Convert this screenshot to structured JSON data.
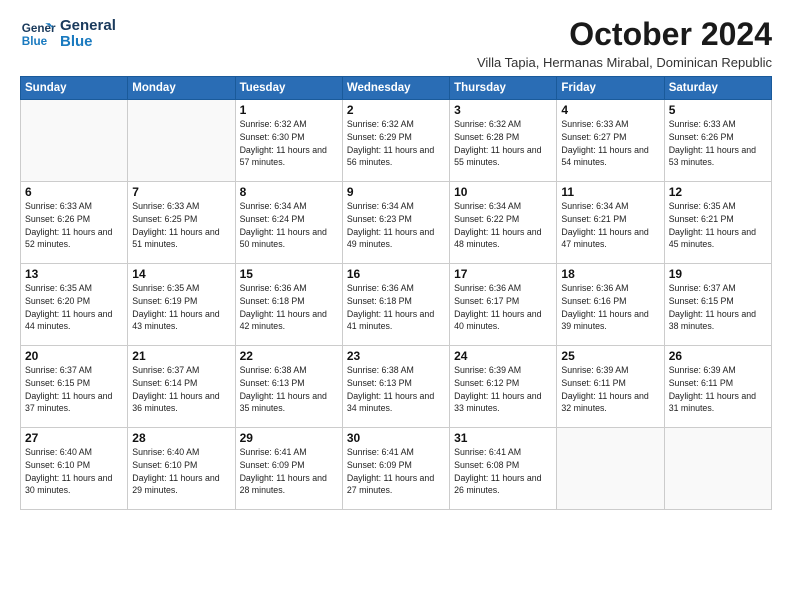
{
  "logo": {
    "line1": "General",
    "line2": "Blue"
  },
  "title": "October 2024",
  "subtitle": "Villa Tapia, Hermanas Mirabal, Dominican Republic",
  "weekdays": [
    "Sunday",
    "Monday",
    "Tuesday",
    "Wednesday",
    "Thursday",
    "Friday",
    "Saturday"
  ],
  "weeks": [
    [
      {
        "day": "",
        "info": ""
      },
      {
        "day": "",
        "info": ""
      },
      {
        "day": "1",
        "info": "Sunrise: 6:32 AM\nSunset: 6:30 PM\nDaylight: 11 hours\nand 57 minutes."
      },
      {
        "day": "2",
        "info": "Sunrise: 6:32 AM\nSunset: 6:29 PM\nDaylight: 11 hours\nand 56 minutes."
      },
      {
        "day": "3",
        "info": "Sunrise: 6:32 AM\nSunset: 6:28 PM\nDaylight: 11 hours\nand 55 minutes."
      },
      {
        "day": "4",
        "info": "Sunrise: 6:33 AM\nSunset: 6:27 PM\nDaylight: 11 hours\nand 54 minutes."
      },
      {
        "day": "5",
        "info": "Sunrise: 6:33 AM\nSunset: 6:26 PM\nDaylight: 11 hours\nand 53 minutes."
      }
    ],
    [
      {
        "day": "6",
        "info": "Sunrise: 6:33 AM\nSunset: 6:26 PM\nDaylight: 11 hours\nand 52 minutes."
      },
      {
        "day": "7",
        "info": "Sunrise: 6:33 AM\nSunset: 6:25 PM\nDaylight: 11 hours\nand 51 minutes."
      },
      {
        "day": "8",
        "info": "Sunrise: 6:34 AM\nSunset: 6:24 PM\nDaylight: 11 hours\nand 50 minutes."
      },
      {
        "day": "9",
        "info": "Sunrise: 6:34 AM\nSunset: 6:23 PM\nDaylight: 11 hours\nand 49 minutes."
      },
      {
        "day": "10",
        "info": "Sunrise: 6:34 AM\nSunset: 6:22 PM\nDaylight: 11 hours\nand 48 minutes."
      },
      {
        "day": "11",
        "info": "Sunrise: 6:34 AM\nSunset: 6:21 PM\nDaylight: 11 hours\nand 47 minutes."
      },
      {
        "day": "12",
        "info": "Sunrise: 6:35 AM\nSunset: 6:21 PM\nDaylight: 11 hours\nand 45 minutes."
      }
    ],
    [
      {
        "day": "13",
        "info": "Sunrise: 6:35 AM\nSunset: 6:20 PM\nDaylight: 11 hours\nand 44 minutes."
      },
      {
        "day": "14",
        "info": "Sunrise: 6:35 AM\nSunset: 6:19 PM\nDaylight: 11 hours\nand 43 minutes."
      },
      {
        "day": "15",
        "info": "Sunrise: 6:36 AM\nSunset: 6:18 PM\nDaylight: 11 hours\nand 42 minutes."
      },
      {
        "day": "16",
        "info": "Sunrise: 6:36 AM\nSunset: 6:18 PM\nDaylight: 11 hours\nand 41 minutes."
      },
      {
        "day": "17",
        "info": "Sunrise: 6:36 AM\nSunset: 6:17 PM\nDaylight: 11 hours\nand 40 minutes."
      },
      {
        "day": "18",
        "info": "Sunrise: 6:36 AM\nSunset: 6:16 PM\nDaylight: 11 hours\nand 39 minutes."
      },
      {
        "day": "19",
        "info": "Sunrise: 6:37 AM\nSunset: 6:15 PM\nDaylight: 11 hours\nand 38 minutes."
      }
    ],
    [
      {
        "day": "20",
        "info": "Sunrise: 6:37 AM\nSunset: 6:15 PM\nDaylight: 11 hours\nand 37 minutes."
      },
      {
        "day": "21",
        "info": "Sunrise: 6:37 AM\nSunset: 6:14 PM\nDaylight: 11 hours\nand 36 minutes."
      },
      {
        "day": "22",
        "info": "Sunrise: 6:38 AM\nSunset: 6:13 PM\nDaylight: 11 hours\nand 35 minutes."
      },
      {
        "day": "23",
        "info": "Sunrise: 6:38 AM\nSunset: 6:13 PM\nDaylight: 11 hours\nand 34 minutes."
      },
      {
        "day": "24",
        "info": "Sunrise: 6:39 AM\nSunset: 6:12 PM\nDaylight: 11 hours\nand 33 minutes."
      },
      {
        "day": "25",
        "info": "Sunrise: 6:39 AM\nSunset: 6:11 PM\nDaylight: 11 hours\nand 32 minutes."
      },
      {
        "day": "26",
        "info": "Sunrise: 6:39 AM\nSunset: 6:11 PM\nDaylight: 11 hours\nand 31 minutes."
      }
    ],
    [
      {
        "day": "27",
        "info": "Sunrise: 6:40 AM\nSunset: 6:10 PM\nDaylight: 11 hours\nand 30 minutes."
      },
      {
        "day": "28",
        "info": "Sunrise: 6:40 AM\nSunset: 6:10 PM\nDaylight: 11 hours\nand 29 minutes."
      },
      {
        "day": "29",
        "info": "Sunrise: 6:41 AM\nSunset: 6:09 PM\nDaylight: 11 hours\nand 28 minutes."
      },
      {
        "day": "30",
        "info": "Sunrise: 6:41 AM\nSunset: 6:09 PM\nDaylight: 11 hours\nand 27 minutes."
      },
      {
        "day": "31",
        "info": "Sunrise: 6:41 AM\nSunset: 6:08 PM\nDaylight: 11 hours\nand 26 minutes."
      },
      {
        "day": "",
        "info": ""
      },
      {
        "day": "",
        "info": ""
      }
    ]
  ]
}
